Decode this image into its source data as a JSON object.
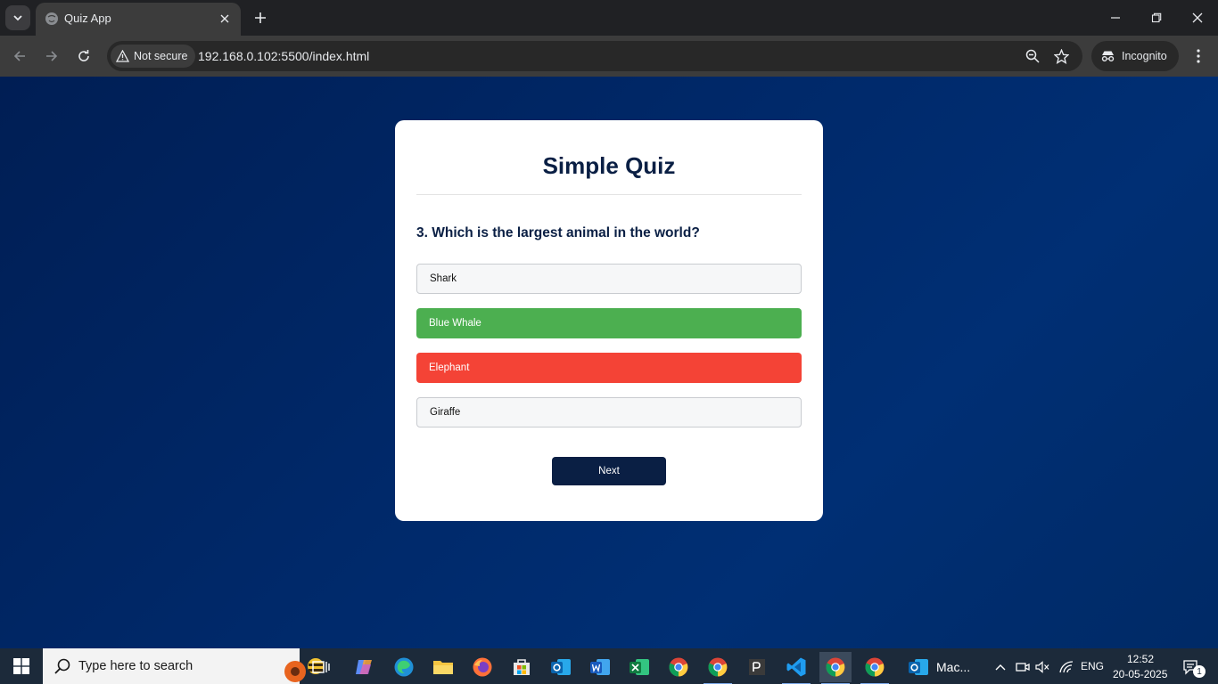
{
  "browser": {
    "tab_title": "Quiz App",
    "security_label": "Not secure",
    "url": "192.168.0.102:5500/index.html",
    "incognito_label": "Incognito"
  },
  "quiz": {
    "title": "Simple Quiz",
    "question": "3. Which is the largest animal in the world?",
    "answers": [
      {
        "text": "Shark",
        "state": "neutral"
      },
      {
        "text": "Blue Whale",
        "state": "correct"
      },
      {
        "text": "Elephant",
        "state": "wrong"
      },
      {
        "text": "Giraffe",
        "state": "neutral"
      }
    ],
    "next_label": "Next",
    "colors": {
      "correct": "#4caf50",
      "wrong": "#f44336",
      "primary": "#0a1f44"
    }
  },
  "taskbar": {
    "search_placeholder": "Type here to search",
    "open_window_label": "Mac...",
    "language": "ENG",
    "time": "12:52",
    "date": "20-05-2025",
    "notification_count": "1"
  }
}
